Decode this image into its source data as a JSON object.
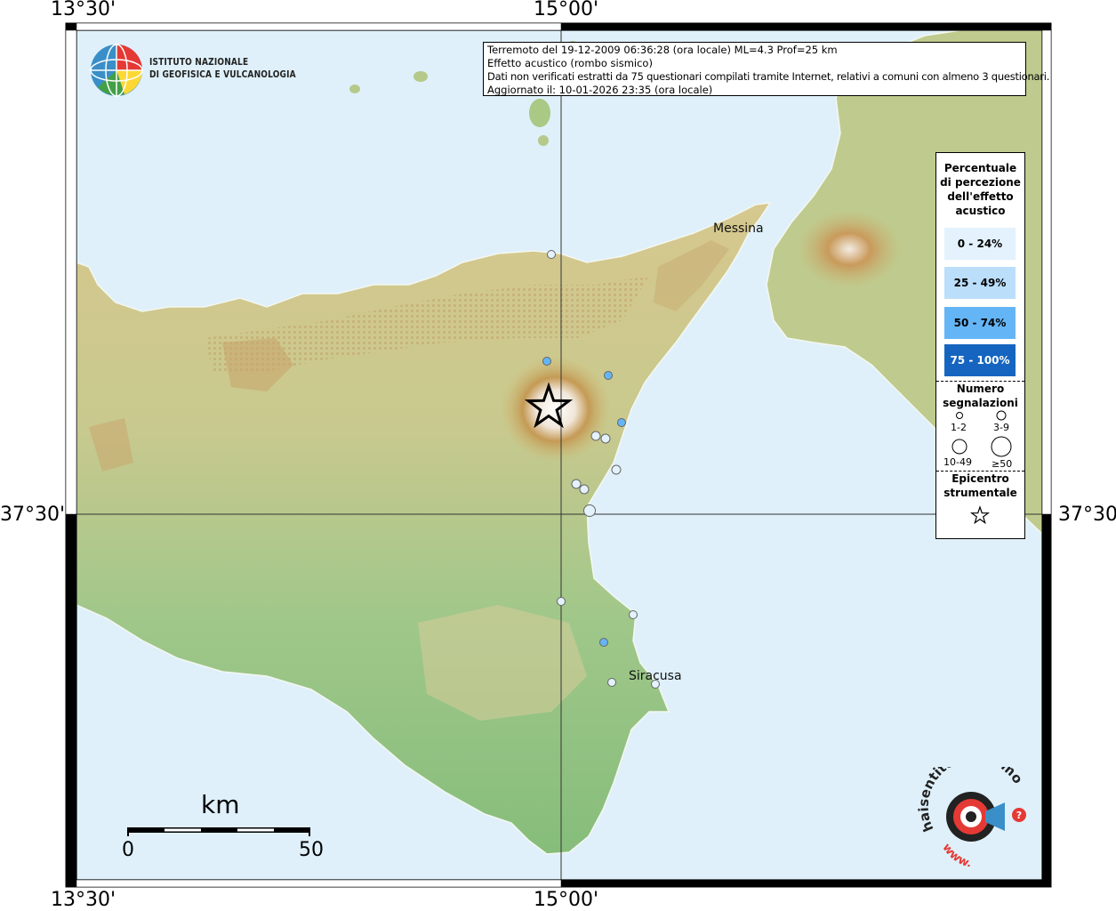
{
  "axes": {
    "lon_left": "13°30'",
    "lon_center": "15°00'",
    "lat_mid": "37°30'"
  },
  "info": {
    "line1": "Terremoto del 19-12-2009 06:36:28 (ora locale) ML=4.3 Prof=25 km",
    "line2": "Effetto acustico (rombo sismico)",
    "line3": "Dati non verificati estratti da 75 questionari compilati tramite Internet, relativi a comuni con almeno 3 questionari.",
    "line4": "Aggiornato il: 10-01-2026 23:35 (ora locale)"
  },
  "logo": {
    "line1": "ISTITUTO NAZIONALE",
    "line2": "DI GEOFISICA E VULCANOLOGIA"
  },
  "legend": {
    "title": [
      "Percentuale",
      "di percezione",
      "dell'effetto",
      "acustico"
    ],
    "classes": [
      {
        "label": "0 - 24%",
        "color": "#e3f2fd",
        "text_color": "#000000"
      },
      {
        "label": "25 - 49%",
        "color": "#bbdefb",
        "text_color": "#000000"
      },
      {
        "label": "50 - 74%",
        "color": "#64b5f6",
        "text_color": "#000000"
      },
      {
        "label": "75 - 100%",
        "color": "#1565c0",
        "text_color": "#ffffff"
      }
    ],
    "count_title": [
      "Numero",
      "segnalazioni"
    ],
    "counts": [
      "1-2",
      "3-9",
      "10-49",
      "≥50"
    ],
    "epicenter_title": [
      "Epicentro",
      "strumentale"
    ]
  },
  "places": {
    "messina": "Messina",
    "siracusa": "Siracusa"
  },
  "scale": {
    "unit": "km",
    "start": "0",
    "end": "50"
  },
  "brand": {
    "site": "www.haisentitoilterremoto.it",
    "icon": "speaker-target-icon"
  },
  "colors": {
    "sea": "#dff0fa",
    "epicenter_star": "#000000"
  }
}
